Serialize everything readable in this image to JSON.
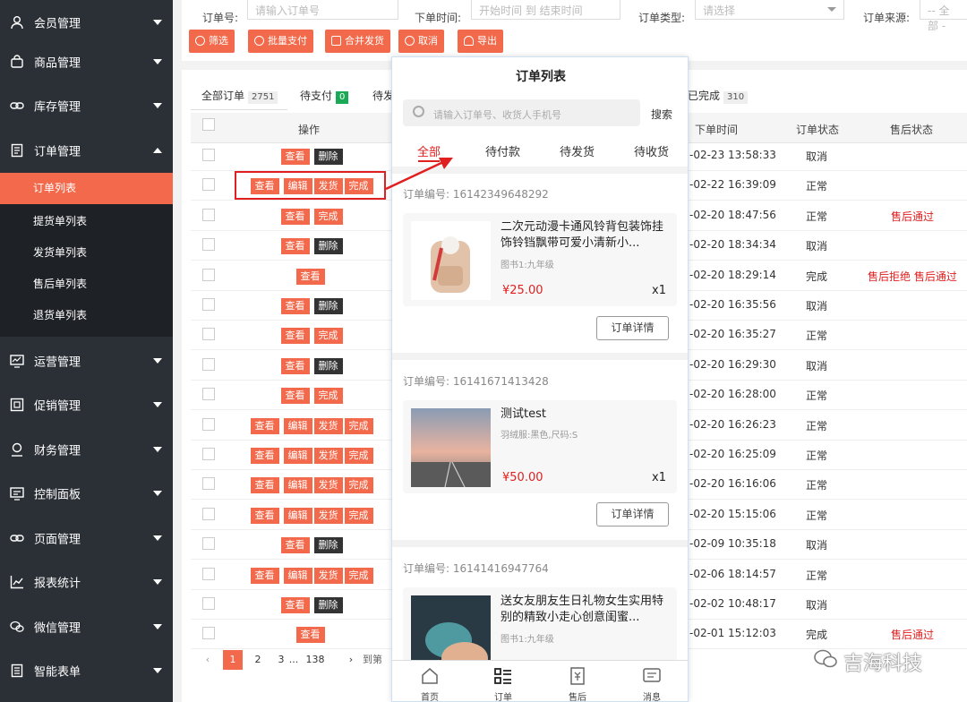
{
  "sidebar": {
    "menus": [
      {
        "label": "会员管理",
        "icon": "user-icon"
      },
      {
        "label": "商品管理",
        "icon": "shopping-bag-icon"
      },
      {
        "label": "库存管理",
        "icon": "link-icon"
      },
      {
        "label": "订单管理",
        "icon": "document-icon"
      },
      {
        "label": "运营管理",
        "icon": "monitor-chart-icon"
      },
      {
        "label": "促销管理",
        "icon": "coupon-icon"
      },
      {
        "label": "财务管理",
        "icon": "finance-icon"
      },
      {
        "label": "控制面板",
        "icon": "dashboard-icon"
      },
      {
        "label": "页面管理",
        "icon": "link-icon"
      },
      {
        "label": "报表统计",
        "icon": "line-chart-icon"
      },
      {
        "label": "微信管理",
        "icon": "wechat-icon"
      },
      {
        "label": "智能表单",
        "icon": "form-icon"
      }
    ],
    "submenu": [
      "订单列表",
      "提货单列表",
      "发货单列表",
      "售后单列表",
      "退货单列表"
    ],
    "active_sub": "订单列表"
  },
  "filters": {
    "order_no_label": "订单号:",
    "order_no_placeholder": "请输入订单号",
    "time_label": "下单时间:",
    "time_placeholder": "开始时间 到 结束时间",
    "type_label": "订单类型:",
    "type_placeholder": "请选择",
    "source_label": "订单来源:",
    "source_placeholder": "-- 全部 -"
  },
  "actions": [
    "筛选",
    "批量支付",
    "合并发货",
    "取消",
    "导出"
  ],
  "tabs": [
    {
      "label": "全部订单",
      "count": "2751"
    },
    {
      "label": "待支付",
      "count": "0"
    },
    {
      "label": "待发"
    },
    {
      "label": "已完成",
      "count": "310"
    }
  ],
  "table": {
    "headers": [
      "操作",
      "下单时间",
      "订单状态",
      "售后状态"
    ],
    "rows": [
      {
        "actions": [
          "查看",
          "删除"
        ],
        "time": "-02-23 13:58:33",
        "status": "取消",
        "after": ""
      },
      {
        "actions": [
          "查看",
          "编辑",
          "发货",
          "完成"
        ],
        "time": "-02-22 16:39:09",
        "status": "正常",
        "after": ""
      },
      {
        "actions": [
          "查看",
          "完成"
        ],
        "time": "-02-20 18:47:56",
        "status": "正常",
        "after": "售后通过"
      },
      {
        "actions": [
          "查看",
          "删除"
        ],
        "time": "-02-20 18:34:34",
        "status": "取消",
        "after": ""
      },
      {
        "actions": [
          "查看"
        ],
        "time": "-02-20 18:29:14",
        "status": "完成",
        "after": "售后拒绝 售后通过"
      },
      {
        "actions": [
          "查看",
          "删除"
        ],
        "time": "-02-20 16:35:56",
        "status": "取消",
        "after": ""
      },
      {
        "actions": [
          "查看",
          "完成"
        ],
        "time": "-02-20 16:35:27",
        "status": "正常",
        "after": ""
      },
      {
        "actions": [
          "查看",
          "删除"
        ],
        "time": "-02-20 16:29:30",
        "status": "取消",
        "after": ""
      },
      {
        "actions": [
          "查看",
          "完成"
        ],
        "time": "-02-20 16:28:00",
        "status": "正常",
        "after": ""
      },
      {
        "actions": [
          "查看",
          "编辑",
          "发货",
          "完成"
        ],
        "time": "-02-20 16:26:23",
        "status": "正常",
        "after": ""
      },
      {
        "actions": [
          "查看",
          "编辑",
          "发货",
          "完成"
        ],
        "time": "-02-20 16:25:09",
        "status": "正常",
        "after": ""
      },
      {
        "actions": [
          "查看",
          "编辑",
          "发货",
          "完成"
        ],
        "time": "-02-20 16:16:06",
        "status": "正常",
        "after": ""
      },
      {
        "actions": [
          "查看",
          "编辑",
          "发货",
          "完成"
        ],
        "time": "-02-20 15:15:06",
        "status": "正常",
        "after": ""
      },
      {
        "actions": [
          "查看",
          "删除"
        ],
        "time": "-02-09 10:35:18",
        "status": "取消",
        "after": ""
      },
      {
        "actions": [
          "查看",
          "编辑",
          "发货",
          "完成"
        ],
        "time": "-02-06 18:14:57",
        "status": "正常",
        "after": ""
      },
      {
        "actions": [
          "查看",
          "删除"
        ],
        "time": "-02-02 10:48:17",
        "status": "取消",
        "after": ""
      },
      {
        "actions": [
          "查看"
        ],
        "time": "-02-01 15:12:03",
        "status": "完成",
        "after": "售后通过"
      }
    ]
  },
  "pagination": {
    "prev": "‹",
    "pages": [
      "1",
      "2",
      "3",
      "...",
      "138"
    ],
    "next": "›",
    "goto": "到第"
  },
  "phone": {
    "title": "订单列表",
    "search_placeholder": "请输入订单号、收货人手机号",
    "search_btn": "搜索",
    "tabs": [
      "全部",
      "待付款",
      "待发货",
      "待收货"
    ],
    "order_no_label": "订单编号:",
    "orders": [
      {
        "no": "16142349648292",
        "title": "二次元动漫卡通风铃背包装饰挂饰铃铛飘带可爱小清新小...",
        "spec": "图书1:九年级",
        "price": "¥25.00",
        "qty": "x1",
        "btn": "订单详情"
      },
      {
        "no": "16141671413428",
        "title": "测试test",
        "spec": "羽绒服:黑色,尺码:S",
        "price": "¥50.00",
        "qty": "x1",
        "btn": "订单详情"
      },
      {
        "no": "16141416947764",
        "title": "送女友朋友生日礼物女生实用特别的精致小走心创意闺蜜...",
        "spec": "图书1:九年级",
        "price": "",
        "qty": "",
        "btn": ""
      }
    ],
    "nav": [
      {
        "label": "首页",
        "icon": "home-icon"
      },
      {
        "label": "订单",
        "icon": "order-list-icon"
      },
      {
        "label": "售后",
        "icon": "after-sale-icon"
      },
      {
        "label": "消息",
        "icon": "message-icon"
      }
    ]
  },
  "watermark": "吉海科技"
}
